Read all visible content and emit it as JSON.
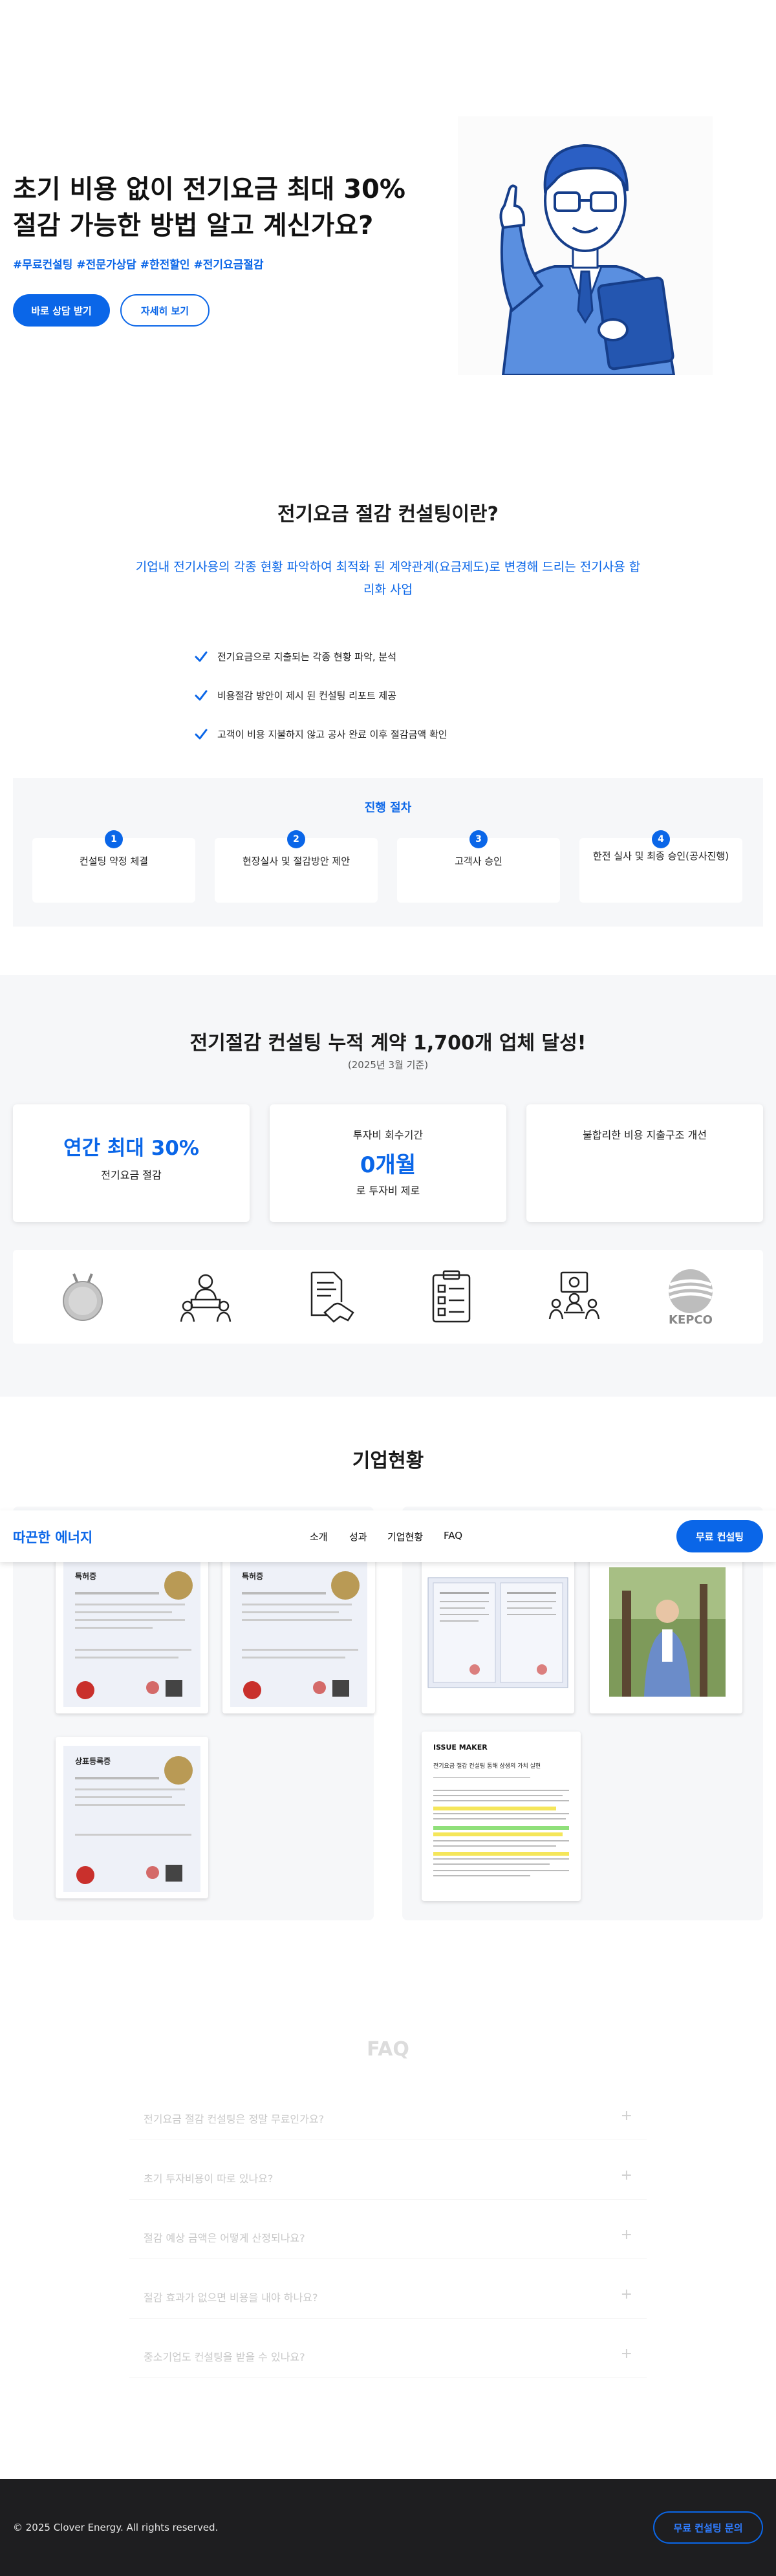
{
  "hero": {
    "title_line1": "초기 비용 없이 전기요금 최대 30%",
    "title_line2": "절감 가능한 방법 알고 계신가요?",
    "tags": "#무료컨설팅 #전문가상담 #한전할인 #전기요금절감",
    "primary_button": "바로 상담 받기",
    "secondary_button": "자세히 보기"
  },
  "intro": {
    "title": "전기요금 절감 컨설팅이란?",
    "desc_line1": "기업내 전기사용의 각종 현황 파악하여 최적화 된 계약관계(요금제도)로 변경해 드리는 전기사용 합",
    "desc_line2": "리화 사업",
    "checks": [
      "전기요금으로 지출되는 각종 현황 파악, 분석",
      "비용절감 방안이 제시 된 컨설팅 리포트 제공",
      "고객이 비용 지불하지 않고 공사 완료 이후 절감금액 확인"
    ]
  },
  "process": {
    "title": "진행 절차",
    "steps": [
      {
        "num": "1",
        "label": "컨설팅 약정 체결"
      },
      {
        "num": "2",
        "label": "현장실사 및 절감방안 제안"
      },
      {
        "num": "3",
        "label": "고객사 승인"
      },
      {
        "num": "4",
        "label": "한전 실사 및 최종 승인(공사진행)"
      }
    ]
  },
  "achieve": {
    "title": "전기절감 컨설팅 누적 계약 1,700개 업체 달성!",
    "sub": "(2025년 3월 기준)",
    "stat1_big": "연간 최대 30%",
    "stat1_small": "전기요금 절감",
    "stat2_top": "투자비 회수기간",
    "stat2_big": "0개월",
    "stat2_bottom": "로 투자비 제로",
    "stat3_text": "불합리한 비용 지출구조 개선",
    "logo_icons": [
      "medal-icon",
      "consulting-people-icon",
      "contract-handshake-icon",
      "checklist-clipboard-icon",
      "presentation-meeting-icon",
      "kepco-logo"
    ],
    "kepco_text": "KEPCO"
  },
  "company": {
    "title": "기업현황",
    "nav": {
      "brand": "따끈한 에너지",
      "items": [
        "소개",
        "성과",
        "기업현황",
        "FAQ"
      ],
      "cta": "무료 컨설팅"
    },
    "cert_title": "특허증",
    "cert_title3": "상표등록증",
    "news_brand": "ISSUE MAKER",
    "news_headline": "전기요금 절감 컨설팅 통해 상생의 가치 실현"
  },
  "faq": {
    "title": "FAQ",
    "items": [
      "전기요금 절감 컨설팅은 정말 무료인가요?",
      "초기 투자비용이 따로 있나요?",
      "절감 예상 금액은 어떻게 산정되나요?",
      "절감 효과가 없으면 비용을 내야 하나요?",
      "중소기업도 컨설팅을 받을 수 있나요?"
    ],
    "plus": "+"
  },
  "footer": {
    "copyright": "© 2025 Clover Energy. All rights reserved.",
    "cta": "무료 컨설팅 문의"
  },
  "colors": {
    "primary": "#0a66e8",
    "panel_bg": "#f6f7f9",
    "footer_bg": "#1e1e20"
  }
}
